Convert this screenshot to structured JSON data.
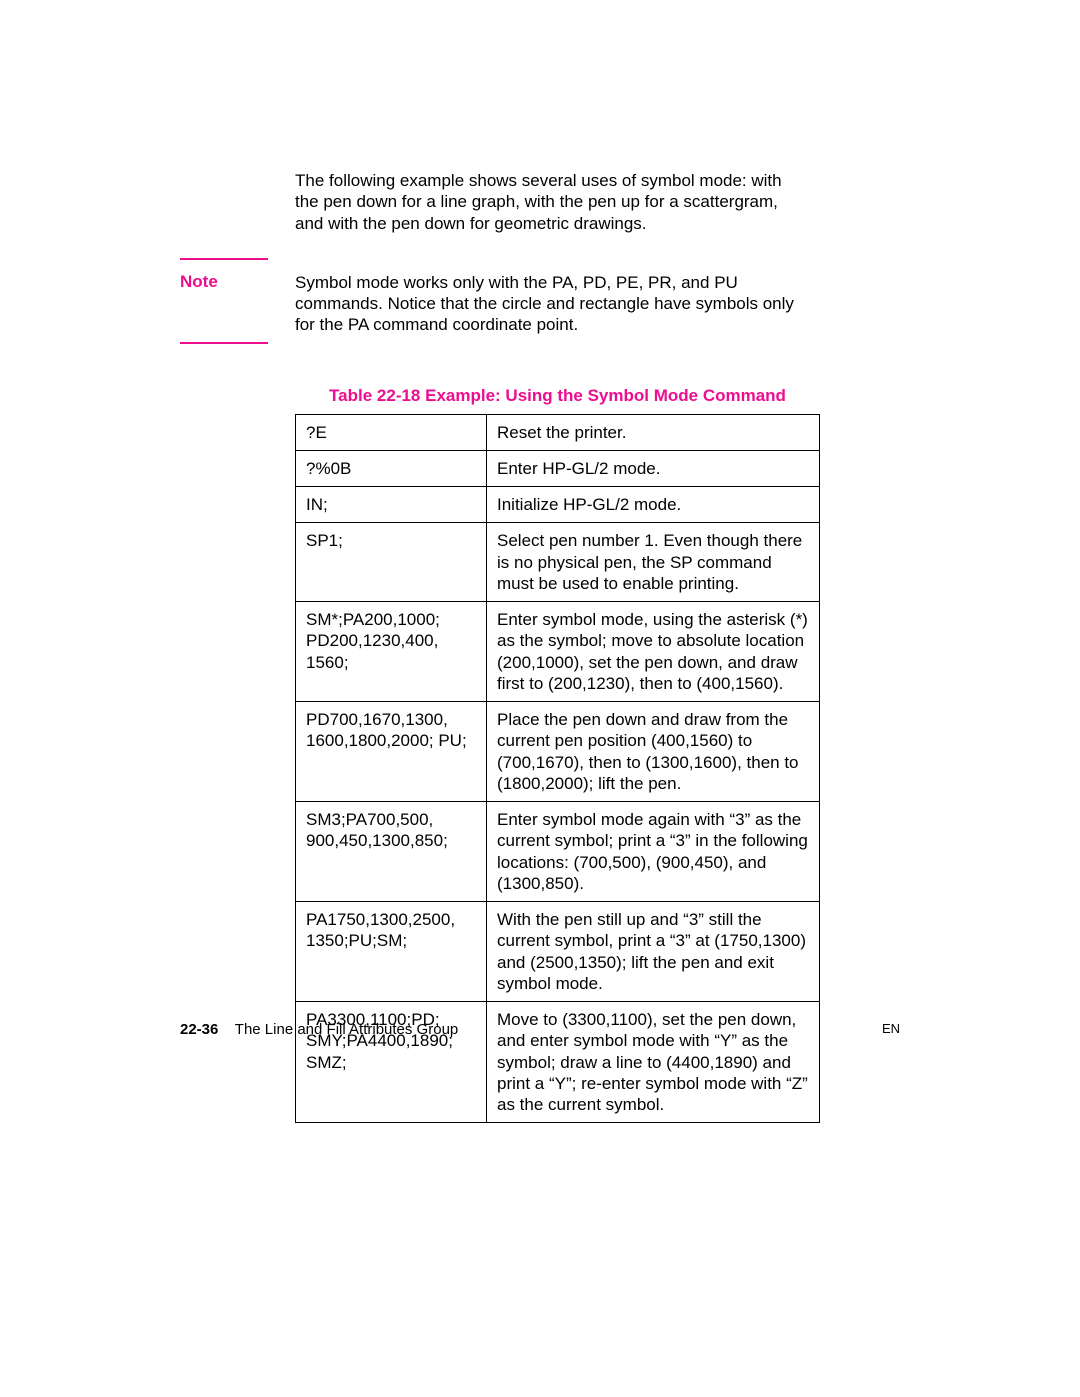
{
  "intro": "The following example shows several uses of symbol mode: with the pen down for a line graph, with the pen up for a scattergram, and with the pen down for geometric drawings.",
  "note": {
    "label": "Note",
    "text": "Symbol mode works only with the PA, PD, PE, PR, and PU commands. Notice that the circle and rectangle have symbols only for the PA command coordinate point."
  },
  "table": {
    "title": "Table 22-18  Example: Using the Symbol Mode Command",
    "rows": [
      {
        "cmd": "?E",
        "desc": "Reset the printer."
      },
      {
        "cmd": "?%0B",
        "desc": "Enter HP-GL/2 mode."
      },
      {
        "cmd": "IN;",
        "desc": "Initialize HP-GL/2 mode."
      },
      {
        "cmd": "SP1;",
        "desc": "Select pen number 1. Even though there is no physical pen, the SP command must be used to enable printing."
      },
      {
        "cmd": "SM*;PA200,1000; PD200,1230,400, 1560;",
        "desc": "Enter symbol mode, using the asterisk (*) as the symbol; move to absolute location (200,1000), set the pen down, and draw first to (200,1230), then to (400,1560)."
      },
      {
        "cmd": "PD700,1670,1300, 1600,1800,2000; PU;",
        "desc": "Place the pen down and draw from the current pen position (400,1560) to (700,1670), then to (1300,1600), then to (1800,2000); lift the pen."
      },
      {
        "cmd": "SM3;PA700,500, 900,450,1300,850;",
        "desc": "Enter symbol mode again with “3” as the current symbol; print a “3” in the following locations: (700,500), (900,450), and (1300,850)."
      },
      {
        "cmd": "PA1750,1300,2500, 1350;PU;SM;",
        "desc": "With the pen still up and “3” still the current symbol, print a “3” at (1750,1300) and (2500,1350); lift the pen and exit symbol mode."
      },
      {
        "cmd": "PA3300,1100;PD; SMY;PA4400,1890; SMZ;",
        "desc": "Move to (3300,1100), set the pen down, and enter symbol mode with “Y” as the symbol; draw a line to (4400,1890) and print a “Y”; re-enter symbol mode with “Z” as the current symbol."
      }
    ]
  },
  "footer": {
    "page": "22-36",
    "section": "The Line and Fill Attributes Group",
    "lang": "EN"
  }
}
